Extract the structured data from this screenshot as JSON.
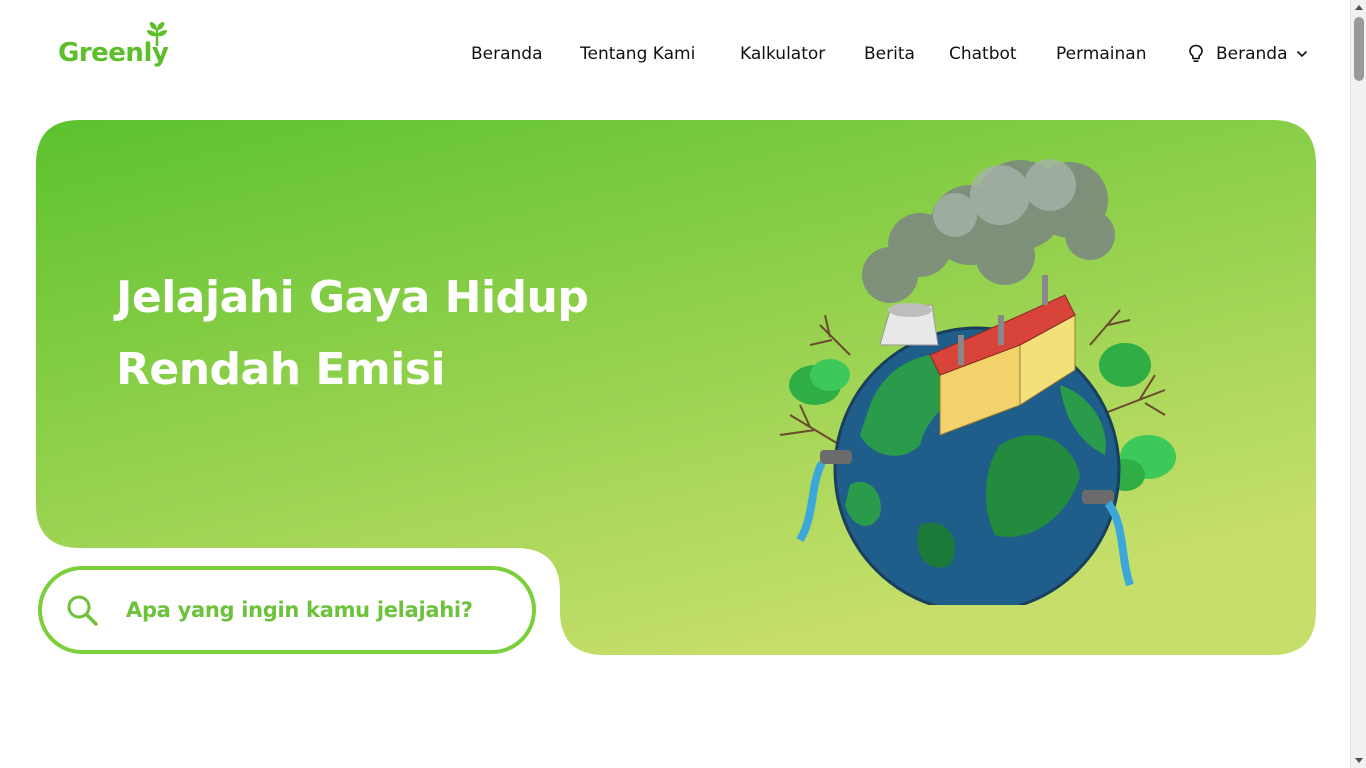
{
  "brand": {
    "name": "Greenly",
    "color": "#5cbf2a"
  },
  "nav": {
    "items": [
      {
        "label": "Beranda"
      },
      {
        "label": "Tentang Kami"
      },
      {
        "label": "Kalkulator"
      },
      {
        "label": "Berita"
      },
      {
        "label": "Chatbot"
      },
      {
        "label": "Permainan"
      }
    ],
    "dropdown": {
      "label": "Beranda",
      "icon": "lightbulb-icon"
    }
  },
  "hero": {
    "title_line1": "Jelajahi Gaya Hidup",
    "title_line2": "Rendah Emisi",
    "gradient_start": "#5cc22e",
    "gradient_end": "#c6df6a"
  },
  "search": {
    "placeholder": "Apa yang ingin kamu jelajahi?",
    "icon": "search-icon"
  }
}
